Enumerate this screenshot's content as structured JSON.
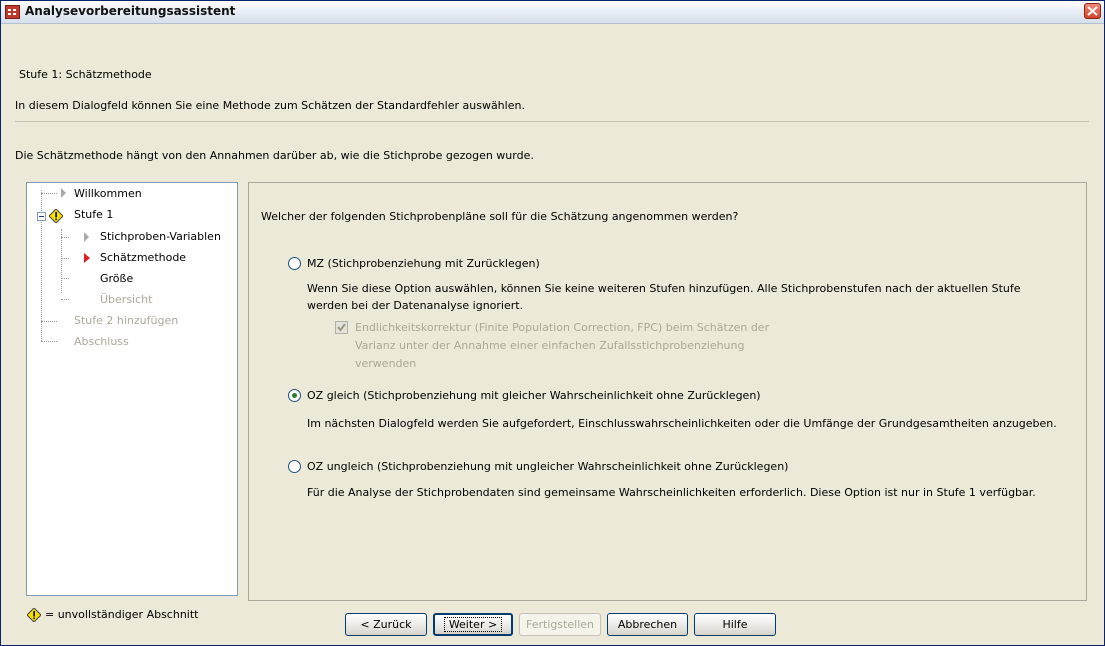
{
  "window": {
    "title": "Analysevorbereitungsassistent"
  },
  "header": {
    "step_title": "Stufe 1: Schätzmethode",
    "description1": "In diesem Dialogfeld können Sie eine Methode zum Schätzen der Standardfehler auswählen.",
    "description2": "Die Schätzmethode hängt von den Annahmen darüber ab, wie die Stichprobe gezogen wurde."
  },
  "tree": {
    "items": [
      {
        "label": "Willkommen",
        "state": "normal"
      },
      {
        "label": "Stufe 1",
        "state": "incomplete"
      },
      {
        "label": "Stichproben-Variablen",
        "state": "normal"
      },
      {
        "label": "Schätzmethode",
        "state": "current"
      },
      {
        "label": "Größe",
        "state": "normal"
      },
      {
        "label": "Übersicht",
        "state": "disabled"
      },
      {
        "label": "Stufe 2 hinzufügen",
        "state": "disabled"
      },
      {
        "label": "Abschluss",
        "state": "disabled"
      }
    ],
    "legend": "= unvollständiger Abschnitt"
  },
  "main": {
    "question": "Welcher der folgenden Stichprobenpläne soll für die Schätzung angenommen werden?",
    "options": [
      {
        "label": "MZ (Stichprobenziehung mit Zurücklegen)",
        "selected": false,
        "description_line1": "Wenn Sie diese Option auswählen, können Sie keine weiteren Stufen hinzufügen. Alle Stichprobenstufen nach der aktuellen Stufe",
        "description_line2": "werden bei der Datenanalyse ignoriert."
      },
      {
        "label": "OZ gleich (Stichprobenziehung mit gleicher Wahrscheinlichkeit ohne Zurücklegen)",
        "selected": true,
        "description": "Im nächsten Dialogfeld werden Sie aufgefordert, Einschlusswahrscheinlichkeiten oder die Umfänge der Grundgesamtheiten anzugeben."
      },
      {
        "label": "OZ ungleich (Stichprobenziehung mit ungleicher Wahrscheinlichkeit ohne Zurücklegen)",
        "selected": false,
        "description": "Für die Analyse der Stichprobendaten sind gemeinsame Wahrscheinlichkeiten erforderlich. Diese Option ist nur in Stufe 1 verfügbar."
      }
    ],
    "fpc_checkbox": {
      "checked": true,
      "enabled": false,
      "line1": "Endlichkeitskorrektur (Finite Population Correction, FPC) beim Schätzen der",
      "line2": "Varianz unter der Annahme einer einfachen Zufallsstichprobenziehung",
      "line3": "verwenden"
    }
  },
  "buttons": {
    "back": "< Zurück",
    "next": "Weiter >",
    "finish": "Fertigstellen",
    "cancel": "Abbrechen",
    "help": "Hilfe"
  },
  "colors": {
    "accent_selected_radio": "#2a7d2a",
    "current_step_arrow": "#e02020",
    "warning_icon": "#f5e000",
    "close_button": "#d2432c"
  }
}
